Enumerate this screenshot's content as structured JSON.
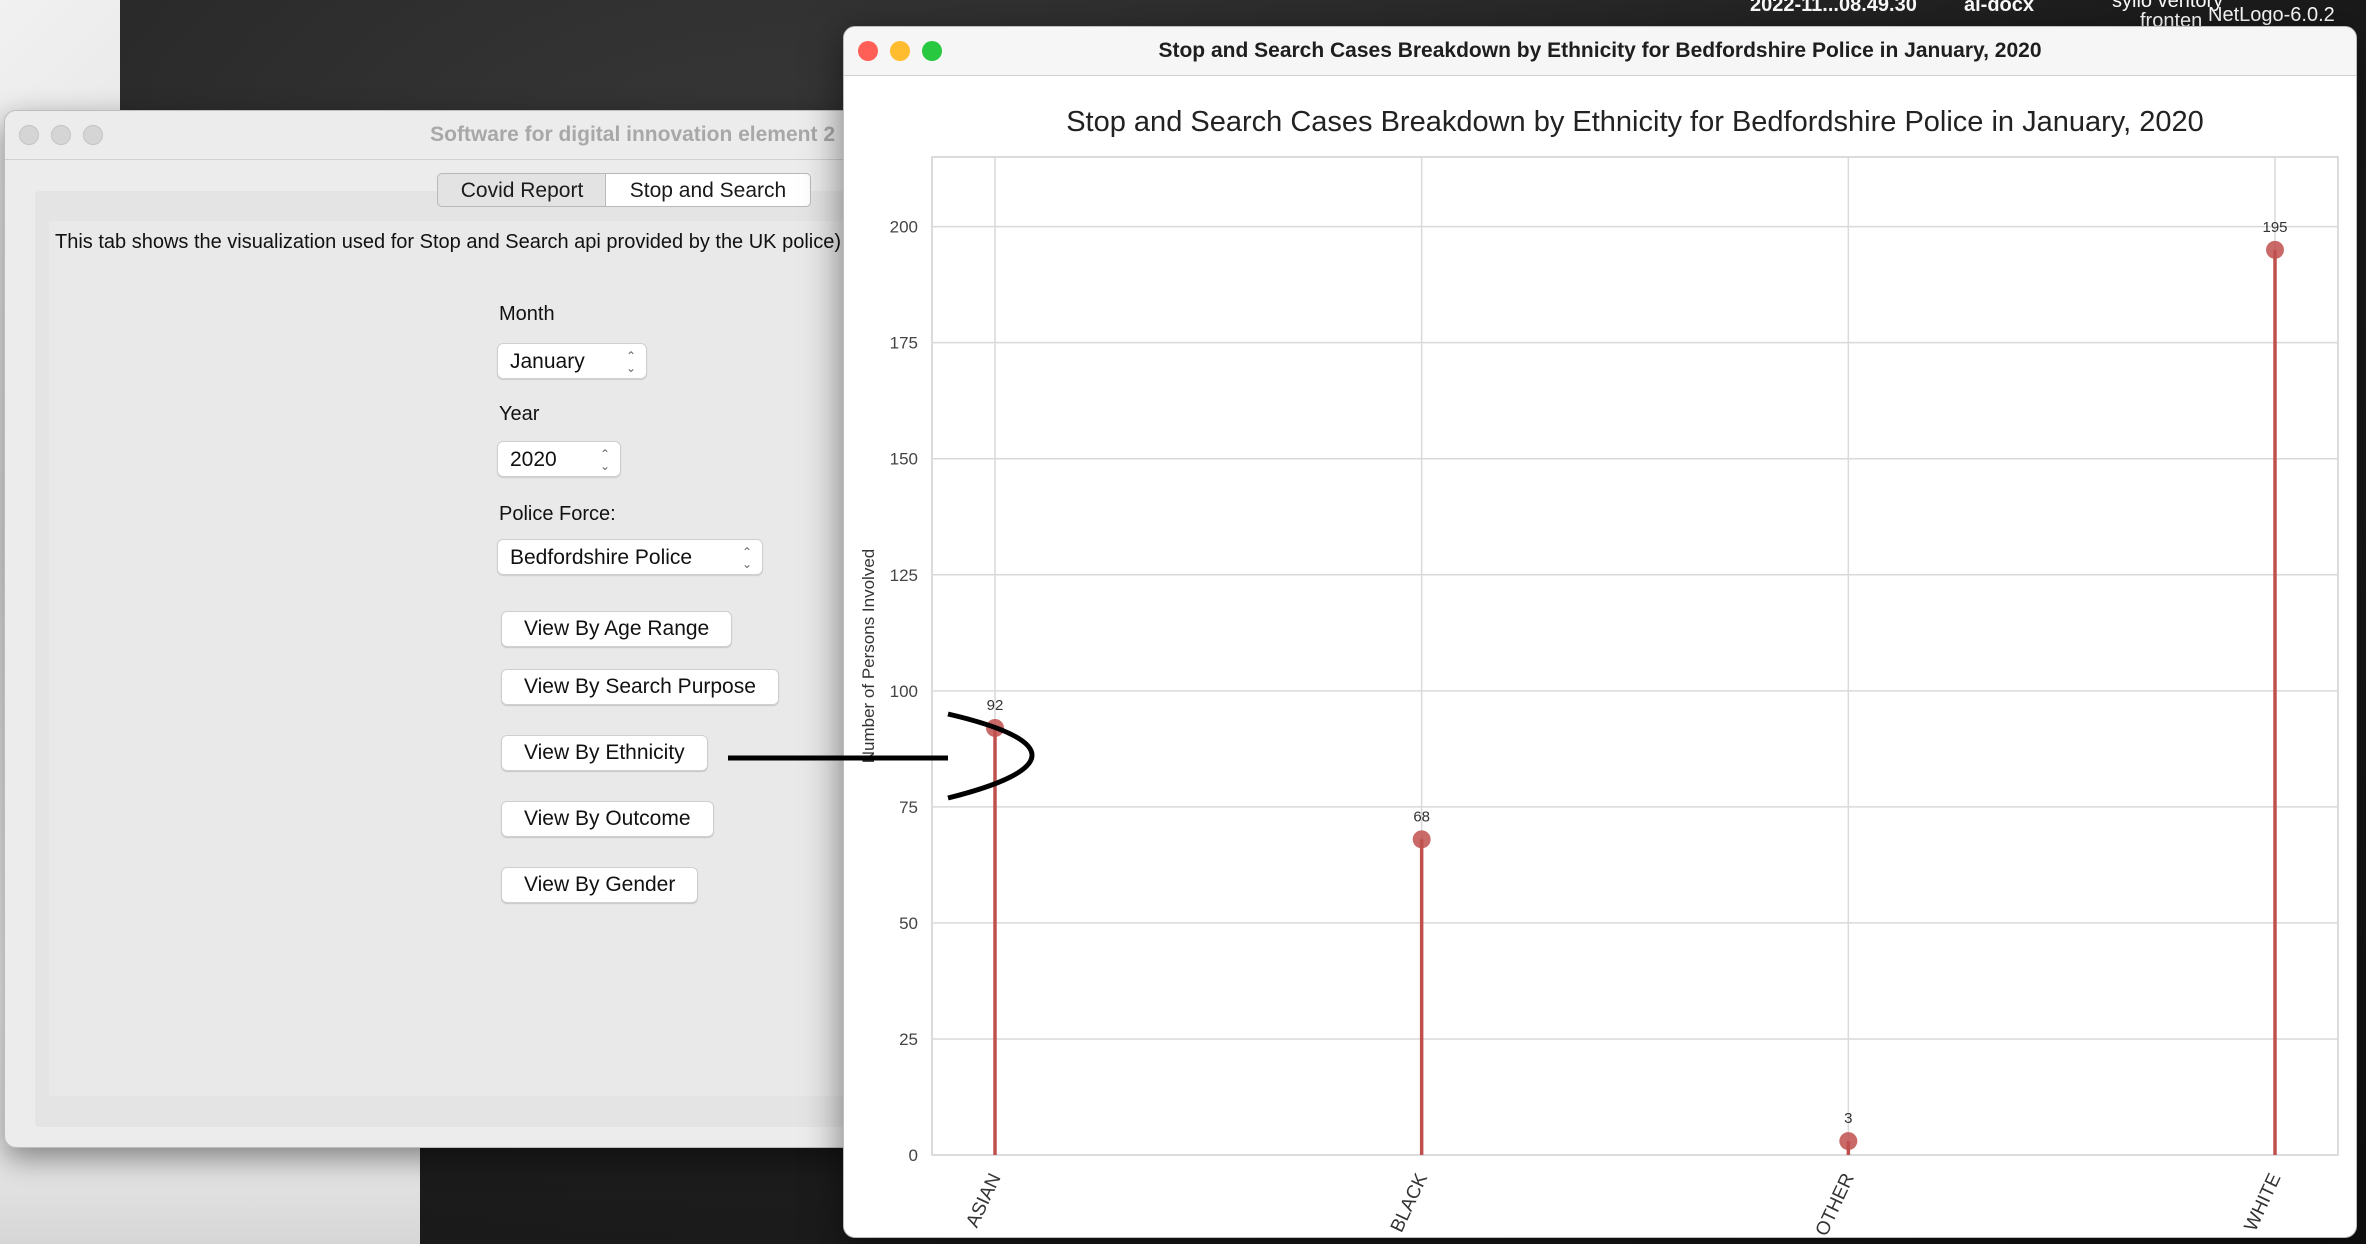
{
  "desktop": {
    "top_labels": [
      "2022-11...08.49.30",
      "al-docx",
      "syllo ventory",
      "fronten",
      "NetLogo-6.0.2"
    ]
  },
  "main_window": {
    "title": "Software for digital innovation element 2",
    "tabs": [
      {
        "label": "Covid Report",
        "selected": false
      },
      {
        "label": "Stop and Search",
        "selected": true
      }
    ],
    "description": "This tab shows the visualization used for Stop and Search api provided by the UK police)",
    "month": {
      "label": "Month",
      "value": "January"
    },
    "year": {
      "label": "Year",
      "value": "2020"
    },
    "police_force": {
      "label": "Police Force:",
      "value": "Bedfordshire Police"
    },
    "buttons": {
      "age_range": "View By Age Range",
      "search_purpose": "View By Search Purpose",
      "ethnicity": "View By Ethnicity",
      "outcome": "View By Outcome",
      "gender": "View By Gender"
    }
  },
  "chart_window": {
    "title": "Stop and Search Cases Breakdown by Ethnicity for Bedfordshire Police in January, 2020"
  },
  "chart_data": {
    "type": "lollipop",
    "title": "Stop and Search Cases Breakdown by Ethnicity for Bedfordshire Police in January, 2020",
    "xlabel": "",
    "ylabel": "Number of Persons Involved",
    "categories": [
      "ASIAN",
      "BLACK",
      "OTHER",
      "WHITE"
    ],
    "values": [
      92,
      68,
      3,
      195
    ],
    "ylim": [
      0,
      215
    ],
    "yticks": [
      0,
      25,
      50,
      75,
      100,
      125,
      150,
      175,
      200
    ],
    "grid": true,
    "color": "#c0504d"
  },
  "colors": {
    "close": "#ff5f57",
    "minimize": "#febc2e",
    "zoom": "#28c840"
  }
}
